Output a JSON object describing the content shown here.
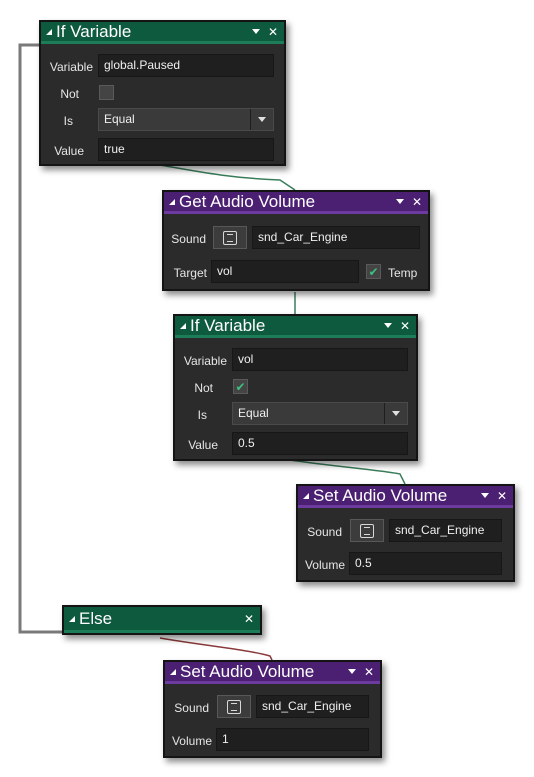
{
  "nodes": {
    "if_paused": {
      "title": "If Variable",
      "variable_label": "Variable",
      "variable_value": "global.Paused",
      "not_label": "Not",
      "not_checked": false,
      "is_label": "Is",
      "is_value": "Equal",
      "value_label": "Value",
      "value_value": "true"
    },
    "get_volume": {
      "title": "Get Audio Volume",
      "sound_label": "Sound",
      "sound_value": "snd_Car_Engine",
      "target_label": "Target",
      "target_value": "vol",
      "temp_label": "Temp",
      "temp_checked": true
    },
    "if_vol": {
      "title": "If Variable",
      "variable_label": "Variable",
      "variable_value": "vol",
      "not_label": "Not",
      "not_checked": true,
      "is_label": "Is",
      "is_value": "Equal",
      "value_label": "Value",
      "value_value": "0.5"
    },
    "set_volume_half": {
      "title": "Set Audio Volume",
      "sound_label": "Sound",
      "sound_value": "snd_Car_Engine",
      "volume_label": "Volume",
      "volume_value": "0.5"
    },
    "else": {
      "title": "Else"
    },
    "set_volume_full": {
      "title": "Set Audio Volume",
      "sound_label": "Sound",
      "sound_value": "snd_Car_Engine",
      "volume_label": "Volume",
      "volume_value": "1"
    }
  },
  "icons": {
    "collapse": "triangle-collapse-icon",
    "menu": "chevron-down-icon",
    "close": "close-icon",
    "check": "checkmark-icon",
    "resource": "resource-picker-icon"
  },
  "colors": {
    "canvas": "#ffffff",
    "node_body": "#2b2b2b",
    "header_condition": "#0e5a3f",
    "header_action": "#4b1f72",
    "wire_flow": "#3a7d5a",
    "wire_else": "#8a3a3a",
    "wire_bracket": "#7a7a7a",
    "check": "#3fbf7f"
  }
}
